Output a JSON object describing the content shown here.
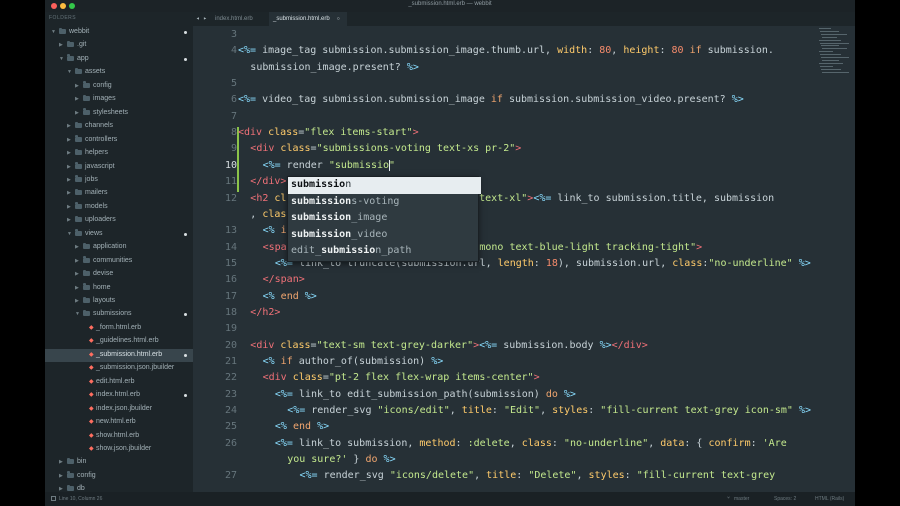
{
  "window": {
    "title": "_submission.html.erb — webbit",
    "traffic_light_colors": [
      "#fc605c",
      "#fdbc40",
      "#34c84a"
    ]
  },
  "sidebar": {
    "header": "FOLDERS",
    "items": [
      {
        "label": "webbit",
        "type": "folder",
        "depth": 0,
        "expanded": true,
        "dot": true
      },
      {
        "label": ".git",
        "type": "folder",
        "depth": 1,
        "expanded": false,
        "dot": false
      },
      {
        "label": "app",
        "type": "folder",
        "depth": 1,
        "expanded": true,
        "dot": true
      },
      {
        "label": "assets",
        "type": "folder",
        "depth": 2,
        "expanded": true,
        "dot": false
      },
      {
        "label": "config",
        "type": "folder",
        "depth": 3,
        "expanded": false,
        "dot": false
      },
      {
        "label": "images",
        "type": "folder",
        "depth": 3,
        "expanded": false,
        "dot": false
      },
      {
        "label": "stylesheets",
        "type": "folder",
        "depth": 3,
        "expanded": false,
        "dot": false
      },
      {
        "label": "channels",
        "type": "folder",
        "depth": 2,
        "expanded": false,
        "dot": false
      },
      {
        "label": "controllers",
        "type": "folder",
        "depth": 2,
        "expanded": false,
        "dot": false
      },
      {
        "label": "helpers",
        "type": "folder",
        "depth": 2,
        "expanded": false,
        "dot": false
      },
      {
        "label": "javascript",
        "type": "folder",
        "depth": 2,
        "expanded": false,
        "dot": false
      },
      {
        "label": "jobs",
        "type": "folder",
        "depth": 2,
        "expanded": false,
        "dot": false
      },
      {
        "label": "mailers",
        "type": "folder",
        "depth": 2,
        "expanded": false,
        "dot": false
      },
      {
        "label": "models",
        "type": "folder",
        "depth": 2,
        "expanded": false,
        "dot": false
      },
      {
        "label": "uploaders",
        "type": "folder",
        "depth": 2,
        "expanded": false,
        "dot": false
      },
      {
        "label": "views",
        "type": "folder",
        "depth": 2,
        "expanded": true,
        "dot": true
      },
      {
        "label": "application",
        "type": "folder",
        "depth": 3,
        "expanded": false,
        "dot": false
      },
      {
        "label": "communities",
        "type": "folder",
        "depth": 3,
        "expanded": false,
        "dot": false
      },
      {
        "label": "devise",
        "type": "folder",
        "depth": 3,
        "expanded": false,
        "dot": false
      },
      {
        "label": "home",
        "type": "folder",
        "depth": 3,
        "expanded": false,
        "dot": false
      },
      {
        "label": "layouts",
        "type": "folder",
        "depth": 3,
        "expanded": false,
        "dot": false
      },
      {
        "label": "submissions",
        "type": "folder",
        "depth": 3,
        "expanded": true,
        "dot": true
      },
      {
        "label": "_form.html.erb",
        "type": "file",
        "depth": 4,
        "dot": false
      },
      {
        "label": "_guidelines.html.erb",
        "type": "file",
        "depth": 4,
        "dot": false
      },
      {
        "label": "_submission.html.erb",
        "type": "file",
        "depth": 4,
        "dot": true,
        "selected": true
      },
      {
        "label": "_submission.json.jbuilder",
        "type": "file",
        "depth": 4,
        "dot": false
      },
      {
        "label": "edit.html.erb",
        "type": "file",
        "depth": 4,
        "dot": false
      },
      {
        "label": "index.html.erb",
        "type": "file",
        "depth": 4,
        "dot": true
      },
      {
        "label": "index.json.jbuilder",
        "type": "file",
        "depth": 4,
        "dot": false
      },
      {
        "label": "new.html.erb",
        "type": "file",
        "depth": 4,
        "dot": false
      },
      {
        "label": "show.html.erb",
        "type": "file",
        "depth": 4,
        "dot": false
      },
      {
        "label": "show.json.jbuilder",
        "type": "file",
        "depth": 4,
        "dot": false
      },
      {
        "label": "bin",
        "type": "folder",
        "depth": 1,
        "expanded": false,
        "dot": false
      },
      {
        "label": "config",
        "type": "folder",
        "depth": 1,
        "expanded": false,
        "dot": false
      },
      {
        "label": "db",
        "type": "folder",
        "depth": 1,
        "expanded": false,
        "dot": false
      }
    ]
  },
  "tabs": [
    {
      "label": "index.html.erb",
      "active": false
    },
    {
      "label": "_submission.html.erb",
      "active": true
    }
  ],
  "tab_nav": "◂ ▸",
  "editor": {
    "current_line": 10,
    "lines": [
      {
        "n": "3",
        "indent": 0,
        "tokens": []
      },
      {
        "n": "4",
        "indent": 0,
        "tokens": [
          [
            "erb",
            "<%="
          ],
          [
            "t",
            " image_tag submission.submission_image.thumb.url, "
          ],
          [
            "attr",
            "width"
          ],
          [
            "t",
            ": "
          ],
          [
            "num",
            "80"
          ],
          [
            "t",
            ", "
          ],
          [
            "attr",
            "height"
          ],
          [
            "t",
            ": "
          ],
          [
            "num",
            "80"
          ],
          [
            "t",
            " "
          ],
          [
            "kw",
            "if"
          ],
          [
            "t",
            " submission."
          ]
        ]
      },
      {
        "n": "",
        "indent": 1,
        "tokens": [
          [
            "t",
            "submission_image.present? "
          ],
          [
            "erb",
            "%>"
          ]
        ]
      },
      {
        "n": "5",
        "indent": 0,
        "tokens": []
      },
      {
        "n": "6",
        "indent": 0,
        "tokens": [
          [
            "erb",
            "<%="
          ],
          [
            "t",
            " video_tag submission.submission_image "
          ],
          [
            "kw",
            "if"
          ],
          [
            "t",
            " submission.submission_video.present? "
          ],
          [
            "erb",
            "%>"
          ]
        ]
      },
      {
        "n": "7",
        "indent": 0,
        "tokens": []
      },
      {
        "n": "8",
        "indent": 0,
        "tokens": [
          [
            "tag",
            "<div"
          ],
          [
            "t",
            " "
          ],
          [
            "attr",
            "class"
          ],
          [
            "t",
            "="
          ],
          [
            "str",
            "\"flex items-start\""
          ],
          [
            "tag",
            ">"
          ]
        ]
      },
      {
        "n": "9",
        "indent": 1,
        "tokens": [
          [
            "tag",
            "<div"
          ],
          [
            "t",
            " "
          ],
          [
            "attr",
            "class"
          ],
          [
            "t",
            "="
          ],
          [
            "str",
            "\"submissions-voting text-xs pr-2\""
          ],
          [
            "tag",
            ">"
          ]
        ]
      },
      {
        "n": "10",
        "indent": 2,
        "tokens": [
          [
            "erb",
            "<%="
          ],
          [
            "t",
            " render "
          ],
          [
            "str",
            "\"submissio\""
          ]
        ]
      },
      {
        "n": "11",
        "indent": 1,
        "tokens": [
          [
            "tag",
            "</div>"
          ]
        ]
      },
      {
        "n": "12",
        "indent": 1,
        "tokens": [
          [
            "tag",
            "<h2"
          ],
          [
            "t",
            " "
          ],
          [
            "attr",
            "class"
          ],
          [
            "t",
            "="
          ],
          [
            "str",
            "\"mb-"
          ],
          [
            "t",
            "                 "
          ],
          [
            "str",
            "center text-xl\""
          ],
          [
            "tag",
            ">"
          ],
          [
            "erb",
            "<%="
          ],
          [
            "t",
            " link_to submission.title, submission"
          ]
        ]
      },
      {
        "n": "",
        "indent": 1,
        "tokens": [
          [
            "t",
            ", "
          ],
          [
            "attr",
            "class"
          ],
          [
            "t",
            ": "
          ],
          [
            "str",
            "\"no"
          ]
        ]
      },
      {
        "n": "13",
        "indent": 2,
        "tokens": [
          [
            "erb",
            "<%"
          ],
          [
            "t",
            " "
          ],
          [
            "kw",
            "if"
          ],
          [
            "t",
            " submi"
          ]
        ]
      },
      {
        "n": "14",
        "indent": 2,
        "tokens": [
          [
            "tag",
            "<span"
          ],
          [
            "t",
            " "
          ],
          [
            "attr",
            "class"
          ],
          [
            "str",
            "                 al font-mono text-blue-light tracking-tight\""
          ],
          [
            "tag",
            ">"
          ]
        ]
      },
      {
        "n": "15",
        "indent": 3,
        "tokens": [
          [
            "erb",
            "<%="
          ],
          [
            "t",
            " link_to truncate(submission.url, "
          ],
          [
            "attr",
            "length"
          ],
          [
            "t",
            ": "
          ],
          [
            "num",
            "18"
          ],
          [
            "t",
            "), submission.url, "
          ],
          [
            "attr",
            "class"
          ],
          [
            "t",
            ":"
          ],
          [
            "str",
            "\"no-underline\""
          ],
          [
            "t",
            " "
          ],
          [
            "erb",
            "%>"
          ]
        ]
      },
      {
        "n": "16",
        "indent": 2,
        "tokens": [
          [
            "tag",
            "</span>"
          ]
        ]
      },
      {
        "n": "17",
        "indent": 2,
        "tokens": [
          [
            "erb",
            "<%"
          ],
          [
            "t",
            " "
          ],
          [
            "kw",
            "end"
          ],
          [
            "t",
            " "
          ],
          [
            "erb",
            "%>"
          ]
        ]
      },
      {
        "n": "18",
        "indent": 1,
        "tokens": [
          [
            "tag",
            "</h2>"
          ]
        ]
      },
      {
        "n": "19",
        "indent": 0,
        "tokens": []
      },
      {
        "n": "20",
        "indent": 1,
        "tokens": [
          [
            "tag",
            "<div"
          ],
          [
            "t",
            " "
          ],
          [
            "attr",
            "class"
          ],
          [
            "t",
            "="
          ],
          [
            "str",
            "\"text-sm text-grey-darker\""
          ],
          [
            "tag",
            ">"
          ],
          [
            "erb",
            "<%="
          ],
          [
            "t",
            " submission.body "
          ],
          [
            "erb",
            "%>"
          ],
          [
            "tag",
            "</div>"
          ]
        ]
      },
      {
        "n": "21",
        "indent": 2,
        "tokens": [
          [
            "erb",
            "<%"
          ],
          [
            "t",
            " "
          ],
          [
            "kw",
            "if"
          ],
          [
            "t",
            " author_of(submission) "
          ],
          [
            "erb",
            "%>"
          ]
        ]
      },
      {
        "n": "22",
        "indent": 2,
        "tokens": [
          [
            "tag",
            "<div"
          ],
          [
            "t",
            " "
          ],
          [
            "attr",
            "class"
          ],
          [
            "t",
            "="
          ],
          [
            "str",
            "\"pt-2 flex flex-wrap items-center\""
          ],
          [
            "tag",
            ">"
          ]
        ]
      },
      {
        "n": "23",
        "indent": 3,
        "tokens": [
          [
            "erb",
            "<%="
          ],
          [
            "t",
            " link_to edit_submission_path(submission) "
          ],
          [
            "kw",
            "do"
          ],
          [
            "t",
            " "
          ],
          [
            "erb",
            "%>"
          ]
        ]
      },
      {
        "n": "24",
        "indent": 4,
        "tokens": [
          [
            "erb",
            "<%="
          ],
          [
            "t",
            " render_svg "
          ],
          [
            "str",
            "\"icons/edit\""
          ],
          [
            "t",
            ", "
          ],
          [
            "attr",
            "title"
          ],
          [
            "t",
            ": "
          ],
          [
            "str",
            "\"Edit\""
          ],
          [
            "t",
            ", "
          ],
          [
            "attr",
            "styles"
          ],
          [
            "t",
            ": "
          ],
          [
            "str",
            "\"fill-current text-grey icon-sm\""
          ],
          [
            "t",
            " "
          ],
          [
            "erb",
            "%>"
          ]
        ]
      },
      {
        "n": "25",
        "indent": 3,
        "tokens": [
          [
            "erb",
            "<%"
          ],
          [
            "t",
            " "
          ],
          [
            "kw",
            "end"
          ],
          [
            "t",
            " "
          ],
          [
            "erb",
            "%>"
          ]
        ]
      },
      {
        "n": "26",
        "indent": 3,
        "tokens": [
          [
            "erb",
            "<%="
          ],
          [
            "t",
            " link_to submission, "
          ],
          [
            "attr",
            "method"
          ],
          [
            "t",
            ": "
          ],
          [
            "str",
            ":delete"
          ],
          [
            "t",
            ", "
          ],
          [
            "attr",
            "class"
          ],
          [
            "t",
            ": "
          ],
          [
            "str",
            "\"no-underline\""
          ],
          [
            "t",
            ", "
          ],
          [
            "attr",
            "data"
          ],
          [
            "t",
            ": { "
          ],
          [
            "attr",
            "confirm"
          ],
          [
            "t",
            ": "
          ],
          [
            "str",
            "'Are"
          ]
        ]
      },
      {
        "n": "",
        "indent": 4,
        "tokens": [
          [
            "str",
            "you sure?'"
          ],
          [
            "t",
            " } "
          ],
          [
            "kw",
            "do"
          ],
          [
            "t",
            " "
          ],
          [
            "erb",
            "%>"
          ]
        ]
      },
      {
        "n": "27",
        "indent": 5,
        "tokens": [
          [
            "erb",
            "<%="
          ],
          [
            "t",
            " render_svg "
          ],
          [
            "str",
            "\"icons/delete\""
          ],
          [
            "t",
            ", "
          ],
          [
            "attr",
            "title"
          ],
          [
            "t",
            ": "
          ],
          [
            "str",
            "\"Delete\""
          ],
          [
            "t",
            ", "
          ],
          [
            "attr",
            "styles"
          ],
          [
            "t",
            ": "
          ],
          [
            "str",
            "\"fill-current text-grey"
          ]
        ]
      }
    ]
  },
  "autocomplete": {
    "selected_index": 0,
    "items": [
      {
        "pre": "",
        "match": "submissio",
        "rest": "n"
      },
      {
        "pre": "",
        "match": "submission",
        "rest": "s-voting"
      },
      {
        "pre": "",
        "match": "submission",
        "rest": "_image"
      },
      {
        "pre": "",
        "match": "submission",
        "rest": "_video"
      },
      {
        "pre": "edit_",
        "match": "submissio",
        "rest": "n_path"
      }
    ]
  },
  "statusbar": {
    "position": "Line 10, Column 26",
    "branch": "master",
    "indentation": "Spaces: 2",
    "syntax": "HTML (Rails)"
  }
}
